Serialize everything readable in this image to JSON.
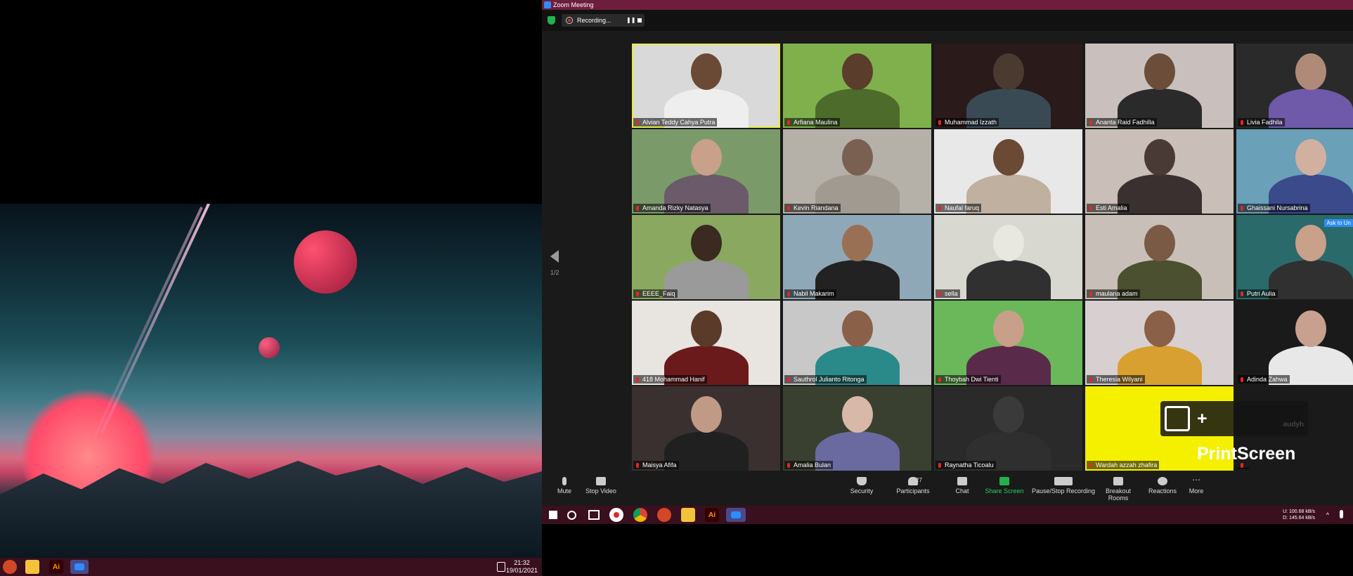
{
  "left_screen": {
    "taskbar": {
      "icons": [
        "powerpoint-icon",
        "folder-icon",
        "illustrator-icon",
        "zoom-icon"
      ],
      "illustrator_label": "Ai",
      "clock_time": "21:32",
      "clock_date": "19/01/2021"
    }
  },
  "zoom": {
    "window_title": "Zoom Meeting",
    "recording_label": "Recording...",
    "page_indicator": "1/2",
    "participants": [
      {
        "name": "Alvian Teddy Cahya Putra",
        "active": true,
        "bg": "#d9d9d9",
        "head": "#6b4a35",
        "body": "#eeeeee"
      },
      {
        "name": "Arfiana Maulina",
        "bg": "#7fb04c",
        "head": "#5a3d2a",
        "body": "#4d6b2a"
      },
      {
        "name": "Muhammad Izzath",
        "bg": "#2a1a1a",
        "head": "#4a3a30",
        "body": "#3a4a55"
      },
      {
        "name": "Ananta Raid Fadhilla",
        "bg": "#c9c0bd",
        "head": "#6b4d3a",
        "body": "#2a2a2a"
      },
      {
        "name": "Livia Fadhila",
        "bg": "#2a2a2a",
        "head": "#b08a78",
        "body": "#6e5aa8"
      },
      {
        "name": "Amanda Rizky Natasya",
        "bg": "#7a9a6a",
        "head": "#c9a08a",
        "body": "#6a5a6a"
      },
      {
        "name": "Kevin Riandana",
        "bg": "#b5b0a8",
        "head": "#7a6050",
        "body": "#a09a90"
      },
      {
        "name": "Naufal faruq",
        "bg": "#e8e8e8",
        "head": "#6b4a35",
        "body": "#bfb0a0"
      },
      {
        "name": "Esti Amalia",
        "bg": "#c9bfb8",
        "head": "#4a3a35",
        "body": "#3a3030"
      },
      {
        "name": "Ghaissani Nursabrina",
        "bg": "#6aa0b8",
        "head": "#d2b0a0",
        "body": "#3a4a8a"
      },
      {
        "name": "EEEE_Faiq",
        "bg": "#8aa860",
        "head": "#3a2a20",
        "body": "#9a9a9a"
      },
      {
        "name": "Nabil Makarim",
        "bg": "#8fa8b8",
        "head": "#9a7055",
        "body": "#222222"
      },
      {
        "name": "sella",
        "bg": "#d8d8d0",
        "head": "#e8e8e0",
        "body": "#303030"
      },
      {
        "name": "maulana adam",
        "bg": "#c8c0b8",
        "head": "#7a5a45",
        "body": "#4a5030"
      },
      {
        "name": "Putri Aulia",
        "bg": "#2a6a6a",
        "head": "#c9a08a",
        "body": "#303030"
      },
      {
        "name": "418 Mohammad Hanif",
        "bg": "#e8e4e0",
        "head": "#5a3a28",
        "body": "#6a1a1a"
      },
      {
        "name": "Sauthrol Julianto Ritonga",
        "bg": "#c8c8c8",
        "head": "#8a6048",
        "body": "#2a8a8a"
      },
      {
        "name": "Thoybah Dwi Tienti",
        "bg": "#6ab85a",
        "head": "#c8a08a",
        "body": "#5a2a4a"
      },
      {
        "name": "Theresia Wilyani",
        "bg": "#d8d0d0",
        "head": "#8a6048",
        "body": "#d8a030"
      },
      {
        "name": "Adinda Zahwa",
        "bg": "#1a1a1a",
        "head": "#c8a090",
        "body": "#e8e8e8"
      },
      {
        "name": "Maisya Afifa",
        "bg": "#3a3030",
        "head": "#c09a85",
        "body": "#202020"
      },
      {
        "name": "Amalia Bulan",
        "bg": "#3a4030",
        "head": "#d8b8a8",
        "body": "#6a6aa0"
      },
      {
        "name": "Raynatha Ticoalu",
        "bg": "#2a2a2a",
        "head": "#3a3a3a",
        "body": "#2f2f2f"
      },
      {
        "name": "Wardah azzah zhafira",
        "bg": "#f5f000",
        "head": "#f5f000",
        "body": "#f5f000"
      },
      {
        "name": "",
        "bg": "#1a1a1a",
        "head": "#1a1a1a",
        "body": "#1a1a1a"
      }
    ],
    "ask_badge": "Ask to Un",
    "watermark": {
      "text": "+ PrintScreen",
      "subtext": "audyh"
    },
    "controls": {
      "mute": "Mute",
      "stop_video": "Stop Video",
      "security": "Security",
      "participants": "Participants",
      "participants_count": "27",
      "chat": "Chat",
      "share_screen": "Share Screen",
      "pause_stop_recording": "Pause/Stop Recording",
      "breakout_rooms": "Breakout Rooms",
      "reactions": "Reactions",
      "more": "More"
    },
    "taskbar": {
      "icons": [
        "windows-start-icon",
        "search-icon",
        "task-view-icon",
        "recorder-icon",
        "chrome-icon",
        "powerpoint-icon",
        "folder-icon",
        "illustrator-icon",
        "zoom-icon"
      ],
      "illustrator_label": "Ai",
      "net_up": "U:   100.68 kB/s",
      "net_down": "D:   145.64 kB/s"
    }
  }
}
